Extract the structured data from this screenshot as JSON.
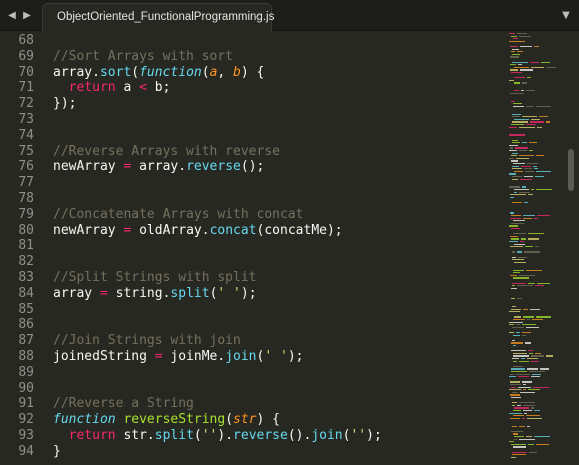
{
  "tabbar": {
    "back_icon": "◀",
    "forward_icon": "▶",
    "tab_title": "ObjectOriented_FunctionalProgramming.js",
    "close_icon": "×",
    "menu_icon": "▼"
  },
  "editor": {
    "lines": [
      {
        "num": "68",
        "html": ""
      },
      {
        "num": "69",
        "html": "<span class=\"c\">//Sort Arrays with sort</span>"
      },
      {
        "num": "70",
        "html": "array.<span class=\"f\">sort</span>(<span class=\"st\">function</span>(<span class=\"p\">a</span>, <span class=\"p\">b</span>) {"
      },
      {
        "num": "71",
        "html": "  <span class=\"k\">return</span> a <span class=\"o\">&lt;</span> b;"
      },
      {
        "num": "72",
        "html": "});"
      },
      {
        "num": "73",
        "html": ""
      },
      {
        "num": "74",
        "html": ""
      },
      {
        "num": "75",
        "html": "<span class=\"c\">//Reverse Arrays with reverse</span>"
      },
      {
        "num": "76",
        "html": "newArray <span class=\"o\">=</span> array.<span class=\"f\">reverse</span>();"
      },
      {
        "num": "77",
        "html": ""
      },
      {
        "num": "78",
        "html": ""
      },
      {
        "num": "79",
        "html": "<span class=\"c\">//Concatenate Arrays with concat</span>"
      },
      {
        "num": "80",
        "html": "newArray <span class=\"o\">=</span> oldArray.<span class=\"f\">concat</span>(concatMe);"
      },
      {
        "num": "81",
        "html": ""
      },
      {
        "num": "82",
        "html": ""
      },
      {
        "num": "83",
        "html": "<span class=\"c\">//Split Strings with split</span>"
      },
      {
        "num": "84",
        "html": "array <span class=\"o\">=</span> string.<span class=\"f\">split</span>(<span class=\"s\">' '</span>);"
      },
      {
        "num": "85",
        "html": ""
      },
      {
        "num": "86",
        "html": ""
      },
      {
        "num": "87",
        "html": "<span class=\"c\">//Join Strings with join</span>"
      },
      {
        "num": "88",
        "html": "joinedString <span class=\"o\">=</span> joinMe.<span class=\"f\">join</span>(<span class=\"s\">' '</span>);"
      },
      {
        "num": "89",
        "html": ""
      },
      {
        "num": "90",
        "html": ""
      },
      {
        "num": "91",
        "html": "<span class=\"c\">//Reverse a String</span>"
      },
      {
        "num": "92",
        "html": "<span class=\"st\">function</span> <span class=\"fn\">reverseString</span>(<span class=\"p\">str</span>) {"
      },
      {
        "num": "93",
        "html": "  <span class=\"k\">return</span> str.<span class=\"f\">split</span>(<span class=\"s\">''</span>).<span class=\"f\">reverse</span>().<span class=\"f\">join</span>(<span class=\"s\">''</span>);"
      },
      {
        "num": "94",
        "html": "}"
      }
    ]
  },
  "colors": {
    "background": "#272822",
    "comment": "#75715e",
    "keyword": "#f92672",
    "builtin": "#66d9ef",
    "string": "#e6db74",
    "parameter": "#fd971f",
    "function_name": "#a6e22e",
    "plain": "#f8f8f2"
  }
}
